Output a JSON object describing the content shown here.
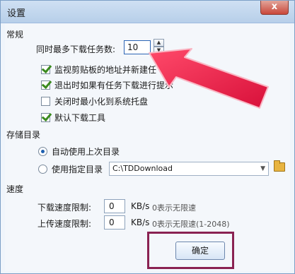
{
  "window": {
    "title": "设置",
    "close_label": "x"
  },
  "general": {
    "section_label": "常规",
    "max_tasks_label": "同时最多下载任务数:",
    "max_tasks_value": "10",
    "checkboxes": [
      {
        "label": "监视剪贴板的地址并新建任",
        "checked": true
      },
      {
        "label": "退出时如果有任务下载进行提示",
        "checked": true
      },
      {
        "label": "关闭时最小化到系统托盘",
        "checked": false
      },
      {
        "label": "默认下载工具",
        "checked": true
      }
    ]
  },
  "storage": {
    "section_label": "存储目录",
    "auto_label": "自动使用上次目录",
    "specified_label": "使用指定目录",
    "path_value": "C:\\TDDownload"
  },
  "speed": {
    "section_label": "速度",
    "download_label": "下载速度限制:",
    "download_value": "0",
    "download_unit": "KB/s",
    "download_hint": "0表示无限速",
    "upload_label": "上传速度限制:",
    "upload_value": "0",
    "upload_unit": "KB/s",
    "upload_hint": "0表示无限速(1-2048)"
  },
  "ok_button": "确定",
  "colors": {
    "accent": "#1d5fb0",
    "arrow": "#e8244a",
    "highlight": "#8a2252"
  },
  "icons": [
    "close-icon",
    "spin-up-icon",
    "spin-down-icon",
    "dropdown-arrow-icon",
    "folder-icon",
    "pointer-arrow-icon"
  ]
}
